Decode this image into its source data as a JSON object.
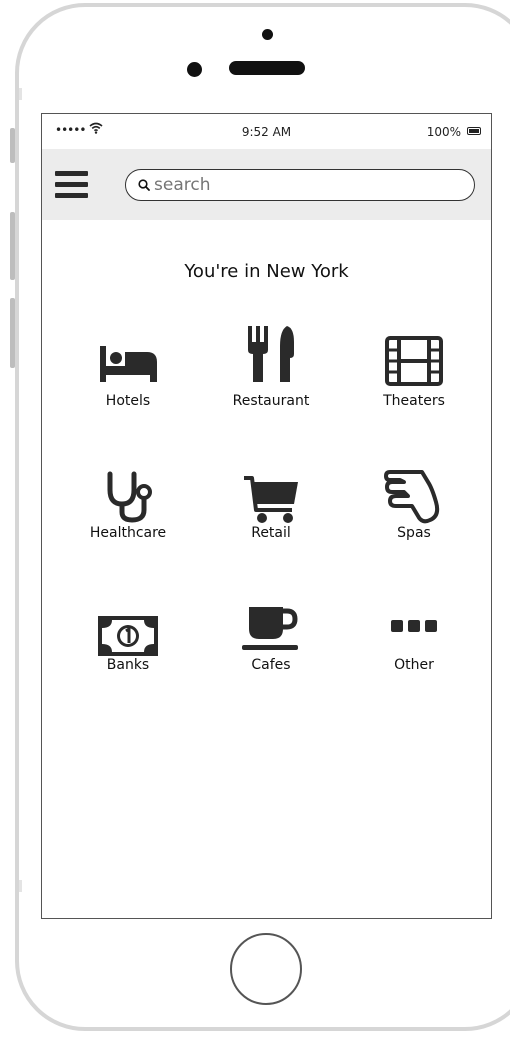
{
  "status_bar": {
    "signal": "•••••",
    "time": "9:52 AM",
    "battery": "100%"
  },
  "header": {
    "menu_icon": "hamburger-menu-icon",
    "search_placeholder": "search"
  },
  "location_text": "You're in New York",
  "categories": [
    {
      "label": "Hotels",
      "icon": "bed-icon"
    },
    {
      "label": "Restaurant",
      "icon": "fork-knife-icon"
    },
    {
      "label": "Theaters",
      "icon": "film-icon"
    },
    {
      "label": "Healthcare",
      "icon": "stethoscope-icon"
    },
    {
      "label": "Retail",
      "icon": "shopping-cart-icon"
    },
    {
      "label": "Spas",
      "icon": "hand-icon"
    },
    {
      "label": "Banks",
      "icon": "money-bill-icon"
    },
    {
      "label": "Cafes",
      "icon": "coffee-cup-icon"
    },
    {
      "label": "Other",
      "icon": "more-dots-icon"
    }
  ],
  "colors": {
    "icon": "#2a2a2a",
    "nav_background": "#ececec",
    "frame": "#d6d6d6"
  }
}
